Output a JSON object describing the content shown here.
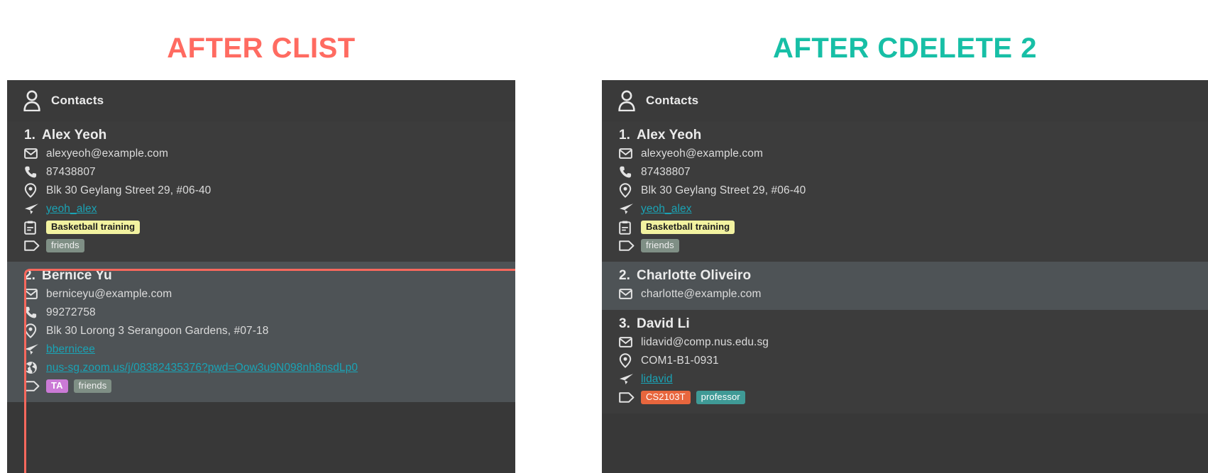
{
  "panels": [
    {
      "heading": "AFTER CLIST",
      "heading_color": "#ff6b61",
      "header_title": "Contacts",
      "contacts": [
        {
          "index": "1.",
          "name": "Alex Yeoh",
          "email": "alexyeoh@example.com",
          "phone": "87438807",
          "address": "Blk 30 Geylang Street 29, #06-40",
          "telegram": "yeoh_alex",
          "note": "Basketball training",
          "tags": [
            {
              "label": "friends",
              "color": "#7f8f85"
            }
          ]
        },
        {
          "index": "2.",
          "name": "Bernice Yu",
          "email": "berniceyu@example.com",
          "phone": "99272758",
          "address": "Blk 30 Lorong 3 Serangoon Gardens, #07-18",
          "telegram": "bbernicee",
          "url": "nus-sg.zoom.us/j/08382435376?pwd=Oow3u9N098nh8nsdLp0",
          "tags": [
            {
              "label": "TA",
              "color": "#cb7ad6"
            },
            {
              "label": "friends",
              "color": "#7f8f85"
            }
          ],
          "selected": true
        }
      ]
    },
    {
      "heading": "AFTER CDELETE 2",
      "heading_color": "#17bfa6",
      "header_title": "Contacts",
      "contacts": [
        {
          "index": "1.",
          "name": "Alex Yeoh",
          "email": "alexyeoh@example.com",
          "phone": "87438807",
          "address": "Blk 30 Geylang Street 29, #06-40",
          "telegram": "yeoh_alex",
          "note": "Basketball training",
          "tags": [
            {
              "label": "friends",
              "color": "#7f8f85"
            }
          ]
        },
        {
          "index": "2.",
          "name": "Charlotte Oliveiro",
          "email": "charlotte@example.com"
        },
        {
          "index": "3.",
          "name": "David Li",
          "email": "lidavid@comp.nus.edu.sg",
          "address": "COM1-B1-0931",
          "telegram": "lidavid",
          "tags": [
            {
              "label": "CS2103T",
              "color": "#e8663d"
            },
            {
              "label": "professor",
              "color": "#3f9a96"
            }
          ]
        }
      ]
    }
  ],
  "icons": {
    "person": "person-icon",
    "email": "envelope-icon",
    "phone": "phone-icon",
    "address": "location-pin-icon",
    "telegram": "telegram-paper-plane-icon",
    "note": "clipboard-note-icon",
    "url": "globe-icon",
    "tag": "tag-icon"
  },
  "colors": {
    "card_background": "#383838",
    "row_odd": "#3c3c3c",
    "row_even": "#4e5356",
    "link": "#1aa3b5",
    "selection_border": "#f9685d"
  }
}
